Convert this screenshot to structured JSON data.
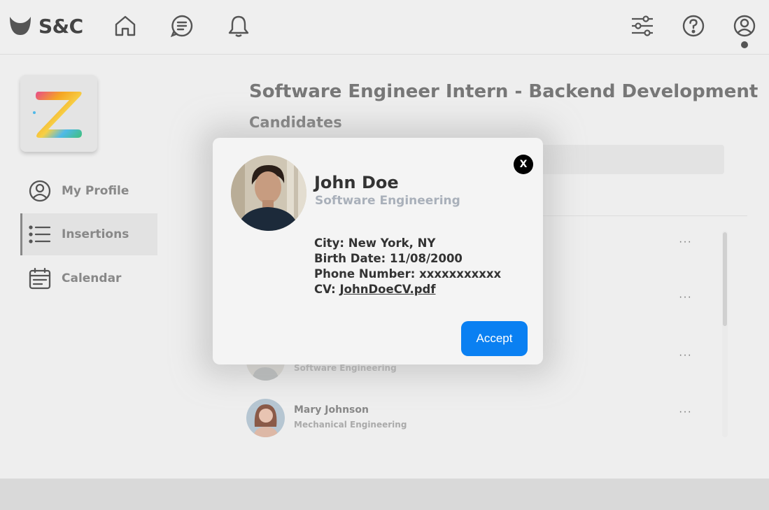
{
  "brand": {
    "name": "S&C"
  },
  "topnav": {
    "icons": [
      "home-icon",
      "messages-icon",
      "bell-icon",
      "filters-icon",
      "help-icon",
      "profile-icon"
    ]
  },
  "sidebar": {
    "items": [
      {
        "label": "My Profile",
        "icon": "user-circle-icon"
      },
      {
        "label": "Insertions",
        "icon": "list-icon",
        "active": true
      },
      {
        "label": "Calendar",
        "icon": "calendar-icon"
      }
    ]
  },
  "main": {
    "title": "Software Engineer Intern - Backend Development",
    "subtitle": "Candidates",
    "candidates": [
      {
        "name": "",
        "department": ""
      },
      {
        "name": "",
        "department": ""
      },
      {
        "name": "",
        "department": "Software Engineering"
      },
      {
        "name": "Mary Johnson",
        "department": "Mechanical Engineering"
      }
    ],
    "more_label": "···"
  },
  "modal": {
    "name": "John Doe",
    "department": "Software Engineering",
    "details": {
      "city_label": "City:",
      "city": "New York, NY",
      "birth_label": "Birth Date:",
      "birth": "11/08/2000",
      "phone_label": "Phone Number:",
      "phone": "xxxxxxxxxxx",
      "cv_label": "CV:",
      "cv": "JohnDoeCV.pdf"
    },
    "close_label": "X",
    "accept_label": "Accept"
  },
  "colors": {
    "accent": "#0a80f2",
    "background": "#eeeeee",
    "footer": "#d9d9d9"
  }
}
